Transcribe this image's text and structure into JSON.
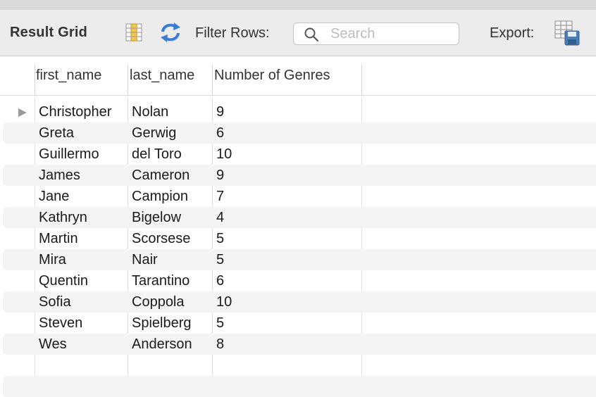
{
  "toolbar": {
    "title": "Result Grid",
    "filter_label": "Filter Rows:",
    "search_placeholder": "Search",
    "search_value": "",
    "export_label": "Export:",
    "icons": [
      "grid-layout-icon",
      "refresh-icon",
      "search-icon",
      "export-table-icon"
    ]
  },
  "grid": {
    "columns": [
      "first_name",
      "last_name",
      "Number of Genres"
    ],
    "rows": [
      {
        "first_name": "Christopher",
        "last_name": "Nolan",
        "genres": "9"
      },
      {
        "first_name": "Greta",
        "last_name": "Gerwig",
        "genres": "6"
      },
      {
        "first_name": "Guillermo",
        "last_name": "del Toro",
        "genres": "10"
      },
      {
        "first_name": "James",
        "last_name": "Cameron",
        "genres": "9"
      },
      {
        "first_name": "Jane",
        "last_name": "Campion",
        "genres": "7"
      },
      {
        "first_name": "Kathryn",
        "last_name": "Bigelow",
        "genres": "4"
      },
      {
        "first_name": "Martin",
        "last_name": "Scorsese",
        "genres": "5"
      },
      {
        "first_name": "Mira",
        "last_name": "Nair",
        "genres": "5"
      },
      {
        "first_name": "Quentin",
        "last_name": "Tarantino",
        "genres": "6"
      },
      {
        "first_name": "Sofia",
        "last_name": "Coppola",
        "genres": "10"
      },
      {
        "first_name": "Steven",
        "last_name": "Spielberg",
        "genres": "5"
      },
      {
        "first_name": "Wes",
        "last_name": "Anderson",
        "genres": "8"
      }
    ]
  },
  "colors": {
    "toolbar_bg": "#ececec",
    "alt_row": "#f4f4f4",
    "refresh_blue": "#3a7bd5",
    "grid_icon_yellow": "#f2c94c"
  }
}
